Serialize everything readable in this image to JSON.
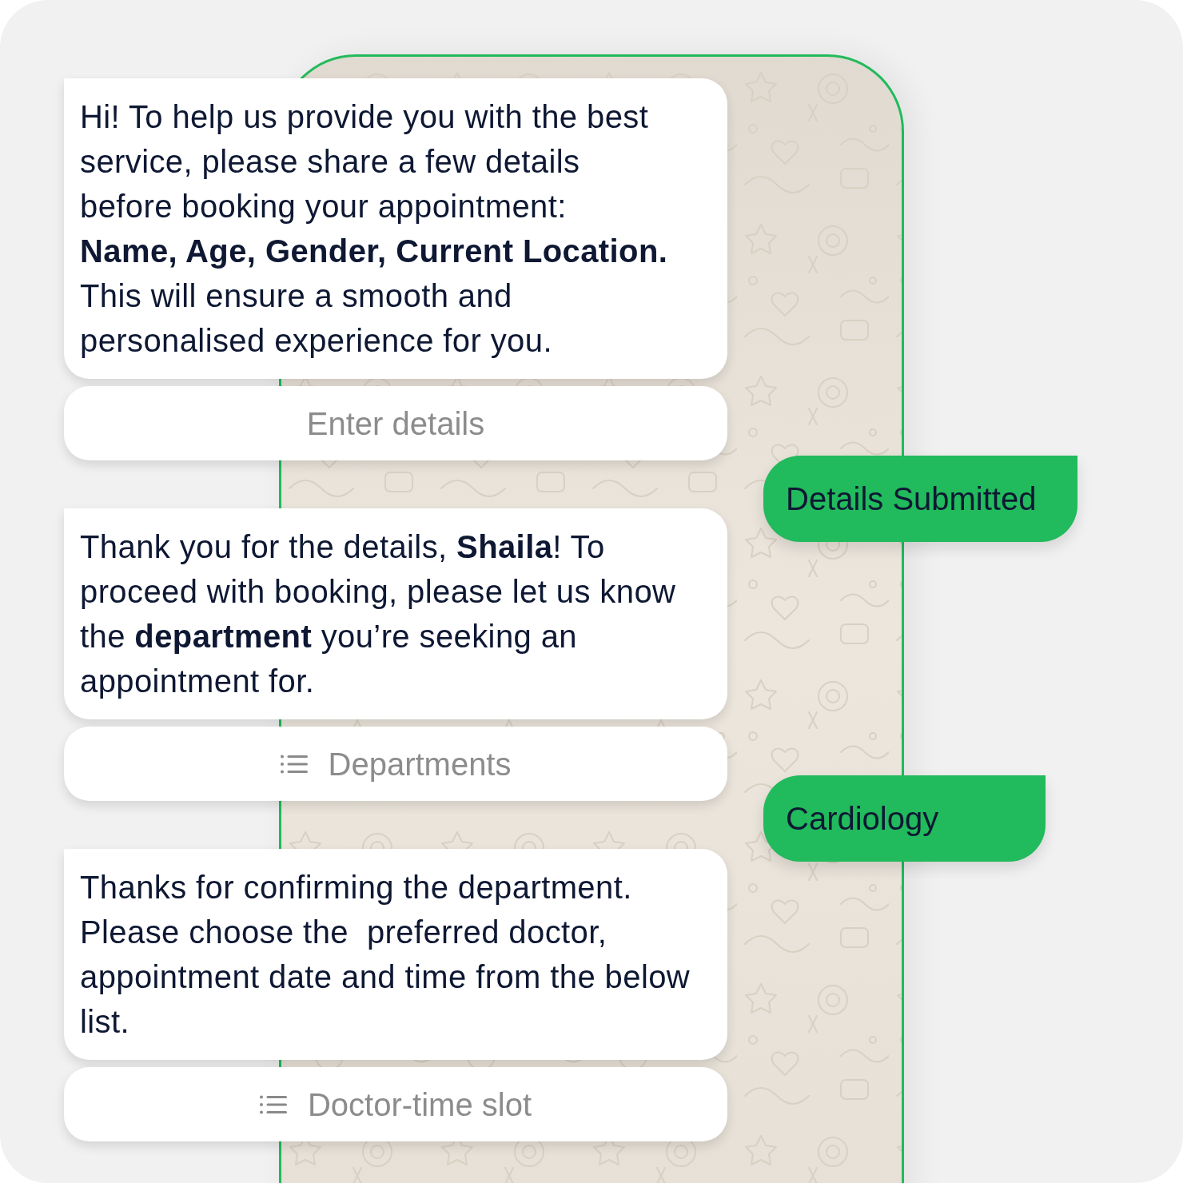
{
  "conversation": [
    {
      "kind": "received",
      "text": "Hi! To help us provide you with the best\nservice, please share a few details\nbefore booking your appointment:\n**Name, Age, Gender, Current Location.**\nThis will ensure a smooth and\npersonalised experience for you.",
      "action": {
        "kind": "reply",
        "label": "Enter details"
      }
    },
    {
      "kind": "sent",
      "text": "Details Submitted"
    },
    {
      "kind": "received",
      "text": "Thank you for the details, **Shaila**! To\nproceed with booking, please let us know\nthe **department** you’re seeking an\nappointment for.",
      "action": {
        "kind": "list",
        "label": "Departments"
      }
    },
    {
      "kind": "sent",
      "text": "Cardiology"
    },
    {
      "kind": "received",
      "text": "Thanks for confirming the department.\nPlease choose the  preferred doctor,\nappointment date and time from the below\nlist.",
      "action": {
        "kind": "list",
        "label": "Doctor-time slot"
      }
    }
  ]
}
